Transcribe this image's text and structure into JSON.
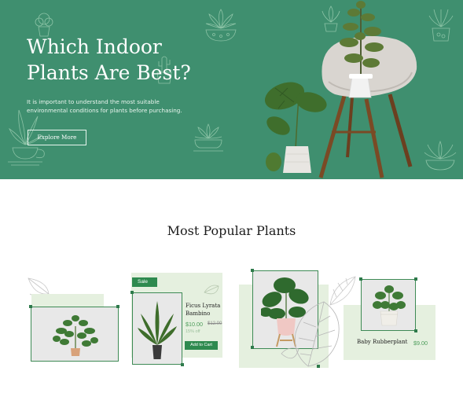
{
  "hero": {
    "title_line1": "Which Indoor",
    "title_line2": "Plants Are Best?",
    "description_line1": "It is important to understand the most suitable",
    "description_line2": "environmental conditions for plants before purchasing.",
    "button_label": "Explore More",
    "background_color": "#3f8f6f"
  },
  "section": {
    "title": "Most Popular Plants"
  },
  "products": [
    {
      "badge": "Sale",
      "name_line1": "Ficus Lyrata",
      "name_line2": "Bambino",
      "price": "$10.00",
      "old_price": "$12.00",
      "discount": "15% off",
      "button_label": "Add to Cart"
    },
    {
      "name": "Baby Rubberplant",
      "price": "$9.00"
    }
  ],
  "colors": {
    "accent_green": "#2e8a4f",
    "card_background": "#e5f0df",
    "price_green": "#4c9c5a"
  }
}
